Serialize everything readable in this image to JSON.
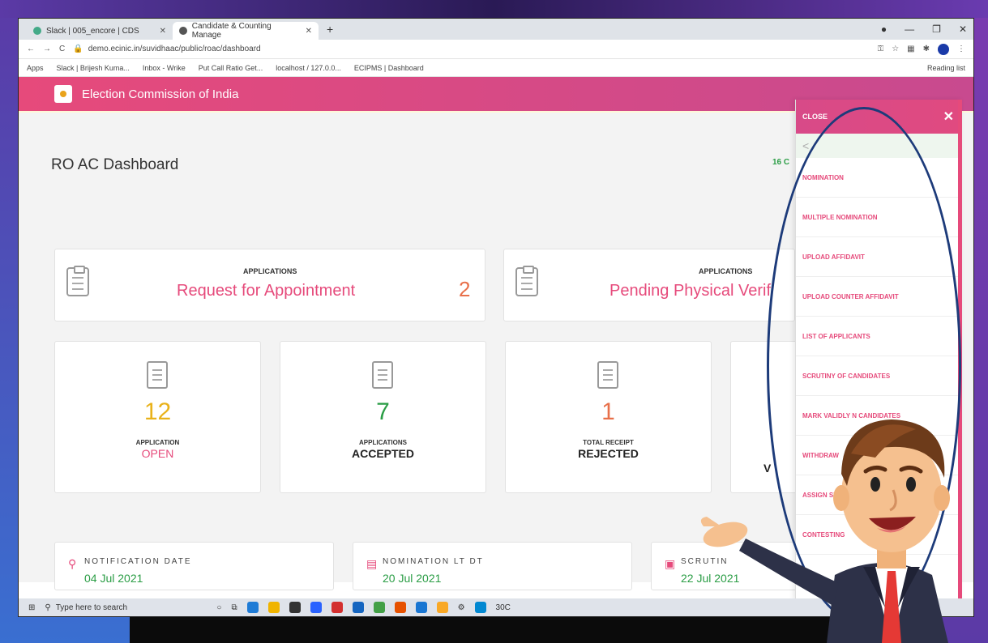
{
  "browser": {
    "tabs": [
      {
        "label": "Slack | 005_encore | CDS"
      },
      {
        "label": "Candidate & Counting Manage"
      }
    ],
    "url": "demo.ecinic.in/suvidhaac/public/roac/dashboard",
    "bookmarks": [
      "Apps",
      "Slack | Brijesh Kuma...",
      "Inbox - Wrike",
      "Put Call Ratio Get...",
      "localhost / 127.0.0...",
      "ECIPMS | Dashboard"
    ],
    "reading_list": "Reading list"
  },
  "app": {
    "title": "Election Commission of India",
    "page_title": "RO AC Dashboard",
    "top_right_fragment": "16 C"
  },
  "cards": {
    "big": [
      {
        "label": "APPLICATIONS",
        "title": "Request for Appointment",
        "count": "2"
      },
      {
        "label": "APPLICATIONS",
        "title": "Pending Physical Verif",
        "count": ""
      }
    ],
    "stats": [
      {
        "value": "12",
        "line1": "APPLICATION",
        "line2": "OPEN",
        "value_color": "#e9b21b",
        "line2_color": "#e64a7b"
      },
      {
        "value": "7",
        "line1": "APPLICATIONS",
        "line2": "ACCEPTED",
        "value_color": "#2a9d45",
        "line2_color": "#222"
      },
      {
        "value": "1",
        "line1": "TOTAL RECEIPT",
        "line2": "REJECTED",
        "value_color": "#e8704a",
        "line2_color": "#222"
      },
      {
        "value": "",
        "line1": "",
        "line2": "V",
        "value_color": "#333",
        "line2_color": "#222"
      }
    ],
    "dates": [
      {
        "label": "NOTIFICATION DATE",
        "value": "04 Jul 2021"
      },
      {
        "label": "NOMINATION LT DT",
        "value": "20 Jul 2021"
      },
      {
        "label": "SCRUTIN",
        "value": "22 Jul 2021"
      }
    ]
  },
  "side_menu": {
    "close_label": "CLOSE",
    "back": "<",
    "items": [
      "NOMINATION",
      "MULTIPLE NOMINATION",
      "UPLOAD AFFIDAVIT",
      "UPLOAD COUNTER AFFIDAVIT",
      "LIST OF APPLICANTS",
      "SCRUTINY OF CANDIDATES",
      "MARK VALIDLY N CANDIDATES",
      "WITHDRAW",
      "ASSIGN SYM",
      "CONTESTING"
    ]
  },
  "taskbar": {
    "search_placeholder": "Type here to search",
    "weather": "30C"
  },
  "colors": {
    "accent": "#e64a7b",
    "header_gradient_end": "#c84a8f",
    "green": "#2a9d45",
    "oval": "#1d3b7a"
  }
}
